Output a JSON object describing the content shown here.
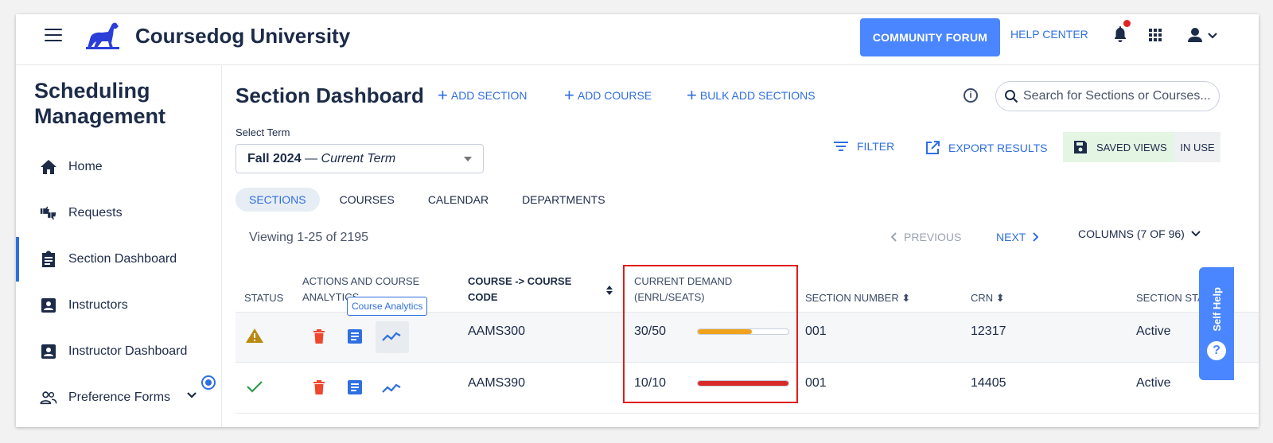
{
  "header": {
    "app_title": "Coursedog University",
    "community_forum": "COMMUNITY FORUM",
    "help_center": "HELP CENTER"
  },
  "sidebar": {
    "title": "Scheduling Management",
    "items": [
      {
        "label": "Home",
        "icon": "home-icon"
      },
      {
        "label": "Requests",
        "icon": "thumbs-icon"
      },
      {
        "label": "Section Dashboard",
        "icon": "clipboard-icon",
        "active": true
      },
      {
        "label": "Instructors",
        "icon": "id-card-icon"
      },
      {
        "label": "Instructor Dashboard",
        "icon": "id-card-icon"
      },
      {
        "label": "Preference Forms",
        "icon": "people-icon"
      }
    ]
  },
  "main": {
    "title": "Section Dashboard",
    "add_section": "ADD SECTION",
    "add_course": "ADD COURSE",
    "bulk_add": "BULK ADD SECTIONS",
    "search_placeholder": "Search for Sections or Courses...",
    "term_label": "Select Term",
    "term_value": "Fall 2024",
    "term_suffix": "— Current Term",
    "filter": "FILTER",
    "export": "EXPORT RESULTS",
    "saved_views": "SAVED VIEWS",
    "in_use": "IN USE",
    "tabs": [
      "SECTIONS",
      "COURSES",
      "CALENDAR",
      "DEPARTMENTS"
    ],
    "viewing": "Viewing 1-25 of 2195",
    "previous": "PREVIOUS",
    "next": "NEXT",
    "columns": "COLUMNS (7 OF 96)"
  },
  "table": {
    "headers": {
      "status": "STATUS",
      "actions": "ACTIONS AND COURSE ANALYTICS",
      "course_code": "COURSE -> COURSE CODE",
      "demand": "CURRENT DEMAND (ENRL/SEATS)",
      "section_number": "SECTION NUMBER",
      "crn": "CRN",
      "section_status": "SECTION STA"
    },
    "tooltip": "Course Analytics",
    "rows": [
      {
        "status": "warning",
        "course_code": "AAMS300",
        "demand": "30/50",
        "demand_fraction": 0.6,
        "demand_color": "#f0a21c",
        "section_number": "001",
        "crn": "12317",
        "section_status": "Active"
      },
      {
        "status": "ok",
        "course_code": "AAMS390",
        "demand": "10/10",
        "demand_fraction": 1.0,
        "demand_color": "#d92a2a",
        "section_number": "001",
        "crn": "14405",
        "section_status": "Active"
      }
    ]
  },
  "self_help": "Self Help",
  "colors": {
    "accent": "#2f6fe0",
    "brand_button": "#4a86ff",
    "delete": "#f0462e",
    "ok": "#2e9b4a",
    "warning": "#b88a10"
  }
}
